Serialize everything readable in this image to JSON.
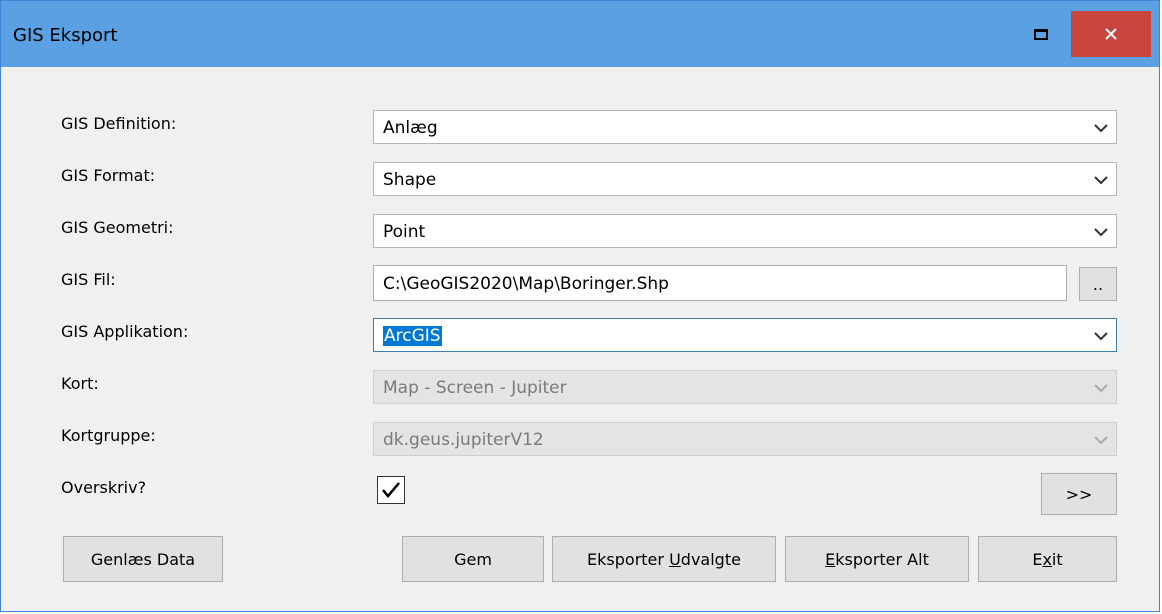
{
  "window": {
    "title": "GIS Eksport"
  },
  "icons": {
    "maximize": "maximize-icon",
    "close": "close-icon",
    "dropdown": "chevron-down-icon",
    "check": "check-icon"
  },
  "colors": {
    "titlebar": "#5aa0e3",
    "close_button": "#c9453d",
    "selection": "#0078d7"
  },
  "form": {
    "definition": {
      "label": "GIS Definition:",
      "value": "Anlæg"
    },
    "format": {
      "label": "GIS Format:",
      "value": "Shape"
    },
    "geometry": {
      "label": "GIS Geometri:",
      "value": "Point"
    },
    "file": {
      "label": "GIS Fil:",
      "value": "C:\\GeoGIS2020\\Map\\Boringer.Shp",
      "browse_label": ".."
    },
    "application": {
      "label": "GIS Applikation:",
      "value": "ArcGIS"
    },
    "map": {
      "label": "Kort:",
      "value": "Map - Screen - Jupiter"
    },
    "map_group": {
      "label": "Kortgruppe:",
      "value": "dk.geus.jupiterV12"
    },
    "overwrite": {
      "label": "Overskriv?",
      "checked": true
    },
    "expand_label": ">>"
  },
  "buttons": {
    "reload": "Genlæs Data",
    "save": "Gem",
    "export_selected_prefix": "Eksporter ",
    "export_selected_accel": "U",
    "export_selected_suffix": "dvalgte",
    "export_all_accel": "E",
    "export_all_suffix": "ksporter Alt",
    "exit_prefix": "E",
    "exit_accel": "x",
    "exit_suffix": "it"
  }
}
